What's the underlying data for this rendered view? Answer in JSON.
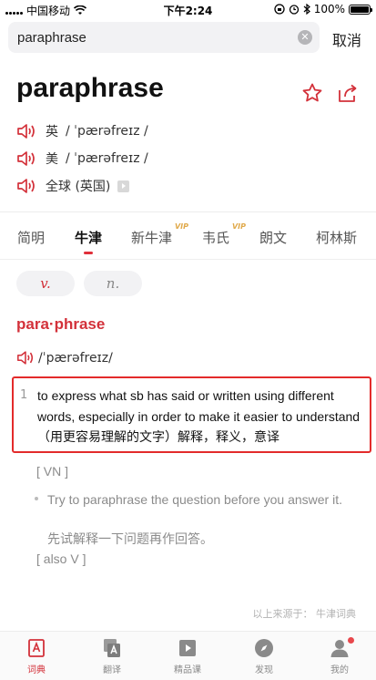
{
  "status_bar": {
    "carrier": "中国移动",
    "time": "下午2:24",
    "battery": "100%",
    "battery_level": 1.0
  },
  "search": {
    "value": "paraphrase",
    "cancel_label": "取消",
    "clear_icon": "clear-icon"
  },
  "headword": "paraphrase",
  "pronunciations": [
    {
      "region": "英",
      "ipa": "/ ˈpærəfreɪz /"
    },
    {
      "region": "美",
      "ipa": "/ ˈpærəfreɪz /"
    },
    {
      "region": "全球 (英国)",
      "ipa": ""
    }
  ],
  "tabs": [
    {
      "label": "简明",
      "vip": ""
    },
    {
      "label": "牛津",
      "vip": ""
    },
    {
      "label": "新牛津",
      "vip": "VIP"
    },
    {
      "label": "韦氏",
      "vip": "VIP"
    },
    {
      "label": "朗文",
      "vip": ""
    },
    {
      "label": "柯林斯",
      "vip": ""
    }
  ],
  "active_tab": "牛津",
  "pos_pills": [
    "v.",
    "n."
  ],
  "entry": {
    "word": "para·phrase",
    "ipa": "/ˈpærəfreɪz/",
    "senses": [
      {
        "num": "1",
        "definition": "to express what sb has said or written using different words, especially in order to make it easier to understand （用更容易理解的文字）解释，释义，意译",
        "grammar": "[ VN ]",
        "example_en": "Try to paraphrase the question before you answer it.",
        "example_zh": "先试解释一下问题再作回答。",
        "also": "[ also V ]"
      }
    ]
  },
  "source": "以上来源于： 牛津词典",
  "bottom_nav": [
    {
      "label": "词典",
      "icon": "dictionary-icon"
    },
    {
      "label": "翻译",
      "icon": "translate-icon"
    },
    {
      "label": "精品课",
      "icon": "course-icon"
    },
    {
      "label": "发现",
      "icon": "compass-icon"
    },
    {
      "label": "我的",
      "icon": "profile-icon"
    }
  ],
  "colors": {
    "accent": "#d3313a",
    "highlight_border": "#e32b2b",
    "vip": "#e0a94a"
  }
}
